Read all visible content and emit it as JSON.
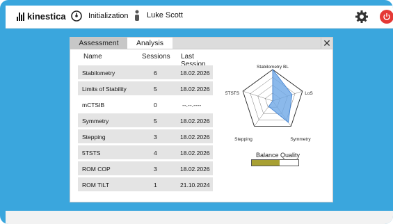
{
  "app": {
    "logo_text": "kinestica"
  },
  "header": {
    "session_label": "Initialization",
    "user_name": "Luke Scott"
  },
  "tabs": [
    {
      "label": "Assessment"
    },
    {
      "label": "Analysis"
    }
  ],
  "close_symbol": "✕",
  "table": {
    "columns": [
      "Name",
      "Sessions",
      "Last Session"
    ],
    "rows": [
      {
        "name": "Stabilometry",
        "sessions": "6",
        "last": "18.02.2026"
      },
      {
        "name": "Limits of Stability",
        "sessions": "5",
        "last": "18.02.2026"
      },
      {
        "name": "mCTSIB",
        "sessions": "0",
        "last": "--.--.----"
      },
      {
        "name": "Symmetry",
        "sessions": "5",
        "last": "18.02.2026"
      },
      {
        "name": "Stepping",
        "sessions": "3",
        "last": "18.02.2026"
      },
      {
        "name": "5TSTS",
        "sessions": "4",
        "last": "18.02.2026"
      },
      {
        "name": "ROM COP",
        "sessions": "3",
        "last": "18.02.2026"
      },
      {
        "name": "ROM TILT",
        "sessions": "1",
        "last": "21.10.2024"
      }
    ]
  },
  "radar": {
    "axes": [
      "Stabilometry BL",
      "LoS",
      "Symmetry",
      "Stepping",
      "5TSTS"
    ],
    "values": [
      1.0,
      0.65,
      0.85,
      0.22,
      0.0
    ],
    "fill_color": "#6ea7e6"
  },
  "balance_quality": {
    "label": "Balance Quality",
    "level": 0.6,
    "fill_color": "#a8a033"
  },
  "icons": {
    "session": "stopwatch-icon",
    "user": "person-icon",
    "settings": "gear-icon",
    "power": "power-icon"
  }
}
